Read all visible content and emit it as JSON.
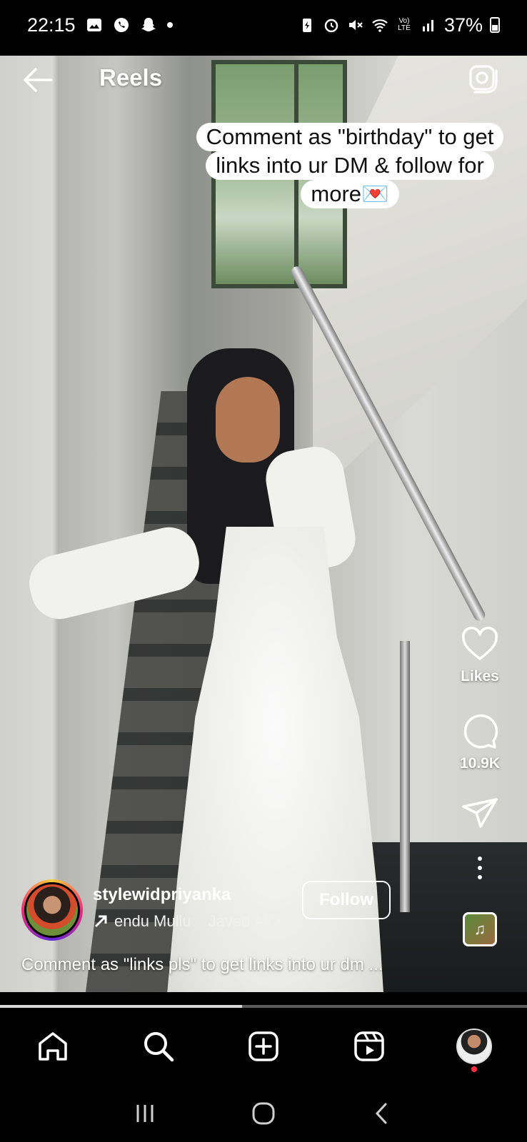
{
  "status_bar": {
    "time": "22:15",
    "left_icons": [
      "gallery-icon",
      "whatsapp-icon",
      "snapchat-icon",
      "notification-dot"
    ],
    "right_icons": [
      "battery-saver-icon",
      "alarm-icon",
      "mute-icon",
      "wifi-icon",
      "volte-icon",
      "signal-icon",
      "battery-icon"
    ],
    "volte_text": "Vo) LTE",
    "battery": "37%"
  },
  "header": {
    "title": "Reels",
    "back_icon": "arrow-left-icon",
    "camera_icon": "camera-icon"
  },
  "overlay_caption": {
    "lines": [
      "Comment as \"birthday\" to get",
      "links into ur DM & follow for",
      "more💌"
    ]
  },
  "actions": {
    "like_label": "Likes",
    "comment_count": "10.9K",
    "like_icon": "heart-icon",
    "comment_icon": "comment-icon",
    "share_icon": "send-icon",
    "more_icon": "more-vertical-icon",
    "audio_icon": "music-note-icon",
    "audio_glyph": "♫"
  },
  "author": {
    "username": "stylewidpriyanka",
    "audio_text": "endu Mullu",
    "audio_artist": "Javed Ali •",
    "follow_label": "Follow"
  },
  "description": "Comment as \"links pls\" to get links into ur dm ...",
  "progress": {
    "fraction": 0.46
  },
  "bottom_nav": [
    "home-icon",
    "search-icon",
    "create-icon",
    "reels-icon",
    "profile-avatar"
  ],
  "android_nav": [
    "recents-icon",
    "home-circle-icon",
    "back-chevron-icon"
  ]
}
